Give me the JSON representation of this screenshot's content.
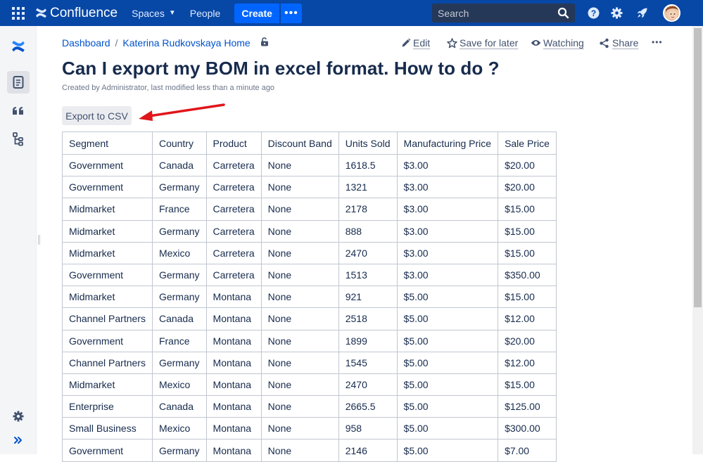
{
  "nav": {
    "brand": "Confluence",
    "spaces_label": "Spaces",
    "people_label": "People",
    "create_label": "Create",
    "more_label": "•••",
    "search_placeholder": "Search"
  },
  "breadcrumb": {
    "items": [
      "Dashboard",
      "Katerina Rudkovskaya Home"
    ],
    "separator": "/"
  },
  "page_actions": {
    "edit": "Edit",
    "save_for_later": "Save for later",
    "watching": "Watching",
    "share": "Share",
    "more": "•••"
  },
  "page": {
    "title": "Can I export my BOM in excel format. How to do ?",
    "byline": "Created by Administrator, last modified less than a minute ago",
    "export_button": "Export to CSV"
  },
  "table": {
    "headers": [
      "Segment",
      "Country",
      "Product",
      "Discount Band",
      "Units Sold",
      "Manufacturing Price",
      "Sale Price"
    ],
    "rows": [
      [
        "Government",
        "Canada",
        "Carretera",
        "None",
        "1618.5",
        "$3.00",
        "$20.00"
      ],
      [
        "Government",
        "Germany",
        "Carretera",
        "None",
        "1321",
        "$3.00",
        "$20.00"
      ],
      [
        "Midmarket",
        "France",
        "Carretera",
        "None",
        "2178",
        "$3.00",
        "$15.00"
      ],
      [
        "Midmarket",
        "Germany",
        "Carretera",
        "None",
        "888",
        "$3.00",
        "$15.00"
      ],
      [
        "Midmarket",
        "Mexico",
        "Carretera",
        "None",
        "2470",
        "$3.00",
        "$15.00"
      ],
      [
        "Government",
        "Germany",
        "Carretera",
        "None",
        "1513",
        "$3.00",
        "$350.00"
      ],
      [
        "Midmarket",
        "Germany",
        "Montana",
        "None",
        "921",
        "$5.00",
        "$15.00"
      ],
      [
        "Channel Partners",
        "Canada",
        "Montana",
        "None",
        "2518",
        "$5.00",
        "$12.00"
      ],
      [
        "Government",
        "France",
        "Montana",
        "None",
        "1899",
        "$5.00",
        "$20.00"
      ],
      [
        "Channel Partners",
        "Germany",
        "Montana",
        "None",
        "1545",
        "$5.00",
        "$12.00"
      ],
      [
        "Midmarket",
        "Mexico",
        "Montana",
        "None",
        "2470",
        "$5.00",
        "$15.00"
      ],
      [
        "Enterprise",
        "Canada",
        "Montana",
        "None",
        "2665.5",
        "$5.00",
        "$125.00"
      ],
      [
        "Small Business",
        "Mexico",
        "Montana",
        "None",
        "958",
        "$5.00",
        "$300.00"
      ],
      [
        "Government",
        "Germany",
        "Montana",
        "None",
        "2146",
        "$5.00",
        "$7.00"
      ]
    ]
  },
  "colors": {
    "nav_bg": "#0747a6",
    "create_bg": "#0065ff",
    "link": "#0052cc",
    "arrow": "#e0161b"
  },
  "icons": {
    "app_switcher": "grid-icon",
    "brand": "confluence-logo-icon",
    "search": "search-icon",
    "help": "help-icon",
    "settings": "gear-icon",
    "notifications": "rocket-icon",
    "sidebar": [
      "confluence-logo-icon",
      "page-icon",
      "quote-icon",
      "tree-icon",
      "gear-icon",
      "expand-icon"
    ]
  }
}
